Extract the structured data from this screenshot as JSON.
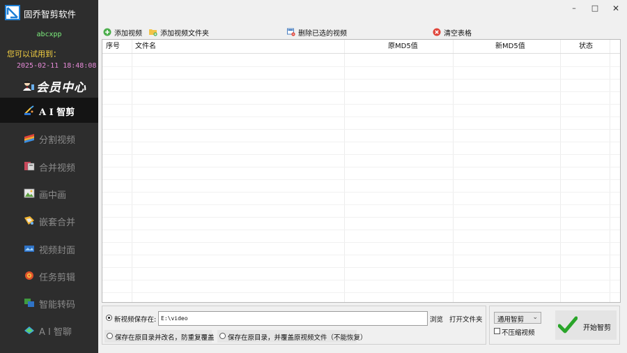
{
  "app": {
    "title": "固乔智剪软件",
    "username": "abcxpp",
    "trial_label": "您可以试用到：",
    "trial_date": "2025-02-11 18:48:08",
    "member_center": "会员中心"
  },
  "window": {
    "minimize": "–",
    "maximize": "□",
    "close": "✕"
  },
  "sidebar": {
    "items": [
      {
        "label": "A I 智剪",
        "icon": "ai-cut-icon",
        "active": true
      },
      {
        "label": "分割视频",
        "icon": "split-video-icon",
        "active": false
      },
      {
        "label": "合并视频",
        "icon": "merge-video-icon",
        "active": false
      },
      {
        "label": "画中画",
        "icon": "picture-in-picture-icon",
        "active": false
      },
      {
        "label": "嵌套合并",
        "icon": "nested-merge-icon",
        "active": false
      },
      {
        "label": "视频封面",
        "icon": "video-cover-icon",
        "active": false
      },
      {
        "label": "任务剪辑",
        "icon": "task-edit-icon",
        "active": false
      },
      {
        "label": "智能转码",
        "icon": "smart-transcode-icon",
        "active": false
      },
      {
        "label": "A I 智聊",
        "icon": "ai-chat-icon",
        "active": false
      }
    ]
  },
  "toolbar": {
    "add_video": "添加视频",
    "add_folder": "添加视频文件夹",
    "delete_selected": "删除已选的视频",
    "clear_table": "清空表格"
  },
  "table": {
    "columns": [
      "序号",
      "文件名",
      "原MD5值",
      "新MD5值",
      "状态"
    ],
    "rows": []
  },
  "save": {
    "new_save_label": "新视频保存在:",
    "path_value": "E:\\video",
    "browse": "浏览",
    "open_folder": "打开文件夹",
    "option_rename": "保存在原目录并改名，防重复覆盖",
    "option_overwrite": "保存在原目录，并覆盖原视频文件（不能恢复）"
  },
  "mode": {
    "selected": "通用智剪",
    "no_compress": "不压缩视频",
    "start": "开始智剪"
  },
  "colors": {
    "sidebar_bg": "#2d2d2d",
    "sidebar_active": "#141414",
    "username": "#7ef07e",
    "trial_label": "#f5d142",
    "trial_date": "#e68ad8",
    "start_check": "#2aa52a"
  }
}
